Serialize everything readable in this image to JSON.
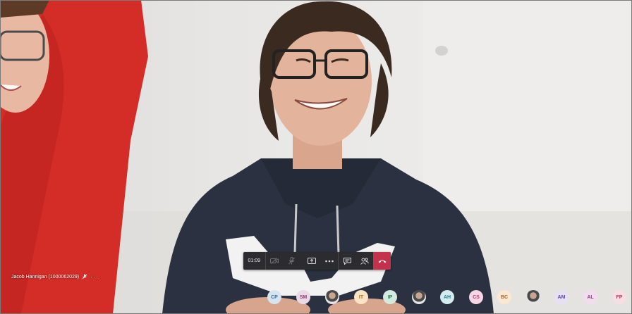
{
  "participant_name": "Jacob Hannigan (1000062029)",
  "name_icon": "mic-off-icon",
  "name_more": "···",
  "controls": {
    "timer": "01:09",
    "camera_icon": "camera-off-icon",
    "mic_icon": "mic-off-icon",
    "share_icon": "share-screen-icon",
    "more_icon": "more-icon",
    "chat_icon": "chat-icon",
    "participants_icon": "participants-icon",
    "hangup_icon": "hang-up-icon",
    "hangup_color": "#c4314b"
  },
  "roster": [
    {
      "initials": "CP",
      "bg": "#d6e4f0",
      "fg": "#3b6e98"
    },
    {
      "initials": "SM",
      "bg": "#ecd9e6",
      "fg": "#8a3e70"
    },
    {
      "initials": "",
      "photo": true
    },
    {
      "initials": "IT",
      "bg": "#fbe3c4",
      "fg": "#b66a19"
    },
    {
      "initials": "IP",
      "bg": "#d3ebdf",
      "fg": "#2f7a55"
    },
    {
      "initials": "",
      "photo": true
    },
    {
      "initials": "AH",
      "bg": "#d2ecf1",
      "fg": "#2e7b8c"
    },
    {
      "initials": "CS",
      "bg": "#f6d5e5",
      "fg": "#b43b7a"
    },
    {
      "initials": "BC",
      "bg": "#fbe7d2",
      "fg": "#a2622a"
    },
    {
      "initials": "",
      "photo": true
    },
    {
      "initials": "AM",
      "bg": "#e6e0f4",
      "fg": "#5e4a9c"
    },
    {
      "initials": "AL",
      "bg": "#f2ddef",
      "fg": "#8b3f83"
    },
    {
      "initials": "FP",
      "bg": "#f8dde3",
      "fg": "#b23a56"
    }
  ]
}
